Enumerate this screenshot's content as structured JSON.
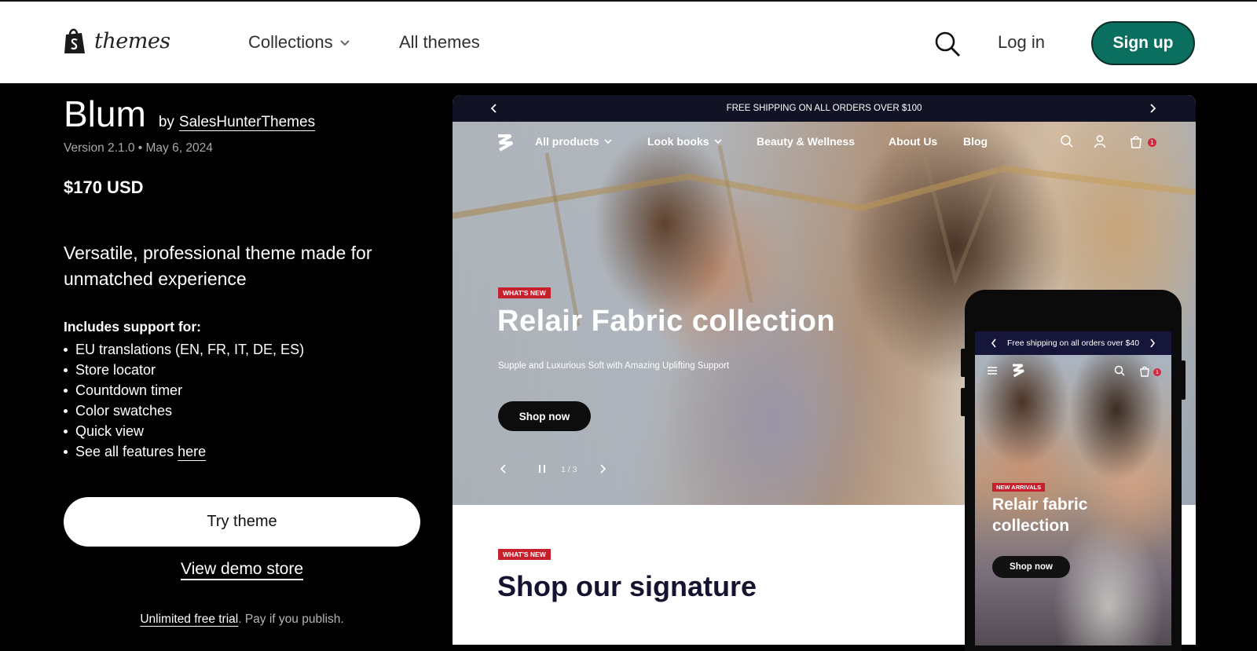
{
  "nav": {
    "logo_text": "themes",
    "collections": "Collections",
    "all_themes": "All themes",
    "login": "Log in",
    "signup": "Sign up"
  },
  "theme": {
    "name": "Blum",
    "by": "by",
    "author": "SalesHunterThemes",
    "version": "Version 2.1.0 • May 6, 2024",
    "price": "$170 USD",
    "tagline": "Versatile, professional theme made for unmatched experience",
    "support_heading": "Includes support for:",
    "features": [
      "EU translations (EN, FR, IT, DE, ES)",
      "Store locator",
      "Countdown timer",
      "Color swatches",
      "Quick view"
    ],
    "see_all_prefix": "See all features ",
    "see_all_link": "here",
    "try_button": "Try theme",
    "demo_link": "View demo store",
    "trial_bold": "Unlimited free trial",
    "trial_rest": ". Pay if you publish."
  },
  "preview": {
    "announcement": "FREE SHIPPING ON ALL ORDERS OVER $100",
    "store_nav": [
      "All products",
      "Look books",
      "Beauty & Wellness",
      "About Us",
      "Blog"
    ],
    "cart_count": "1",
    "hero_badge": "WHAT'S NEW",
    "hero_title": "Relair Fabric collection",
    "hero_subtitle": "Supple and Luxurious Soft with Amazing Uplifting Support",
    "hero_button": "Shop now",
    "slide_counter": "1 / 3",
    "section_badge": "WHAT'S NEW",
    "section_title": "Shop our signature"
  },
  "mobile": {
    "announcement": "Free shipping on all orders over $40",
    "cart_count": "1",
    "badge": "NEW ARRIVALS",
    "title": "Relair fabric collection",
    "button": "Shop now"
  },
  "colors": {
    "brand_green": "#0a6f5e",
    "badge_red": "#c7202d",
    "announce_navy": "#121225"
  }
}
